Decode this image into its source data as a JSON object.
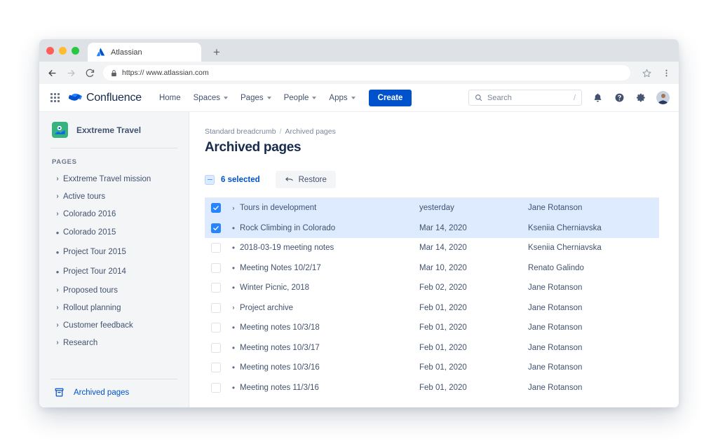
{
  "browser": {
    "tab_title": "Atlassian",
    "tab_favicon": "atlassian-logo-icon",
    "new_tab_label": "+",
    "url": "https:// www.atlassian.com",
    "back_icon": "back-arrow-icon",
    "forward_icon": "forward-arrow-icon",
    "reload_icon": "reload-icon",
    "lock_icon": "lock-icon",
    "bookmark_icon": "star-icon",
    "menu_icon": "kebab-menu-icon"
  },
  "topnav": {
    "app_switcher_icon": "grid-apps-icon",
    "brand": "Confluence",
    "brand_icon": "confluence-logo-icon",
    "items": [
      {
        "label": "Home",
        "has_caret": false
      },
      {
        "label": "Spaces",
        "has_caret": true
      },
      {
        "label": "Pages",
        "has_caret": true
      },
      {
        "label": "People",
        "has_caret": true
      },
      {
        "label": "Apps",
        "has_caret": true
      }
    ],
    "create_label": "Create",
    "search": {
      "placeholder": "Search",
      "icon": "search-icon",
      "shortcut": "/"
    },
    "notifications_icon": "bell-icon",
    "help_icon": "question-circle-icon",
    "settings_icon": "gear-icon",
    "avatar_icon": "user-avatar"
  },
  "sidebar": {
    "space_name": "Exxtreme Travel",
    "space_icon": "space-map-pin-icon",
    "space_icon_color": "#36B37E",
    "section_label": "PAGES",
    "items": [
      {
        "label": "Exxtreme Travel mission",
        "marker": "chevron"
      },
      {
        "label": "Active tours",
        "marker": "chevron"
      },
      {
        "label": "Colorado 2016",
        "marker": "chevron"
      },
      {
        "label": "Colorado 2015",
        "marker": "dot"
      },
      {
        "label": "Project Tour 2015",
        "marker": "dot"
      },
      {
        "label": "Project Tour 2014",
        "marker": "dot"
      },
      {
        "label": "Proposed tours",
        "marker": "chevron"
      },
      {
        "label": "Rollout planning",
        "marker": "chevron"
      },
      {
        "label": "Customer feedback",
        "marker": "chevron"
      },
      {
        "label": "Research",
        "marker": "chevron"
      }
    ],
    "footer_link": {
      "label": "Archived pages",
      "icon": "archive-box-icon",
      "color": "#0052CC"
    }
  },
  "main": {
    "breadcrumb": {
      "parent": "Standard breadcrumb",
      "separator": "/",
      "current": "Archived pages"
    },
    "title": "Archived pages",
    "toolbar": {
      "selected_label": "6 selected",
      "selection_state": "indeterminate",
      "restore_label": "Restore",
      "restore_icon": "undo-arrow-icon"
    },
    "rows": [
      {
        "title": "Tours in development",
        "date": "yesterday",
        "author": "Jane Rotanson",
        "marker": "chevron",
        "checked": true
      },
      {
        "title": "Rock Climbing in Colorado",
        "date": "Mar 14, 2020",
        "author": "Kseniia Cherniavska",
        "marker": "dot",
        "checked": true
      },
      {
        "title": "2018-03-19 meeting notes",
        "date": "Mar 14, 2020",
        "author": "Kseniia Cherniavska",
        "marker": "dot",
        "checked": false
      },
      {
        "title": "Meeting Notes 10/2/17",
        "date": "Mar 10, 2020",
        "author": "Renato Galindo",
        "marker": "dot",
        "checked": false
      },
      {
        "title": "Winter Picnic, 2018",
        "date": "Feb 02, 2020",
        "author": "Jane Rotanson",
        "marker": "dot",
        "checked": false
      },
      {
        "title": "Project archive",
        "date": "Feb 01, 2020",
        "author": "Jane Rotanson",
        "marker": "chevron",
        "checked": false
      },
      {
        "title": "Meeting notes 10/3/18",
        "date": "Feb 01, 2020",
        "author": "Jane Rotanson",
        "marker": "dot",
        "checked": false
      },
      {
        "title": "Meeting notes 10/3/17",
        "date": "Feb 01, 2020",
        "author": "Jane Rotanson",
        "marker": "dot",
        "checked": false
      },
      {
        "title": "Meeting notes 10/3/16",
        "date": "Feb 01, 2020",
        "author": "Jane Rotanson",
        "marker": "dot",
        "checked": false
      },
      {
        "title": "Meeting notes 11/3/16",
        "date": "Feb 01, 2020",
        "author": "Jane Rotanson",
        "marker": "dot",
        "checked": false
      }
    ]
  },
  "colors": {
    "accent": "#0052CC",
    "selected_row": "#DEEBFF",
    "checkbox_checked": "#2684FF",
    "sidebar_bg": "#F4F5F7",
    "text": "#42526E",
    "heading": "#172B4D"
  }
}
